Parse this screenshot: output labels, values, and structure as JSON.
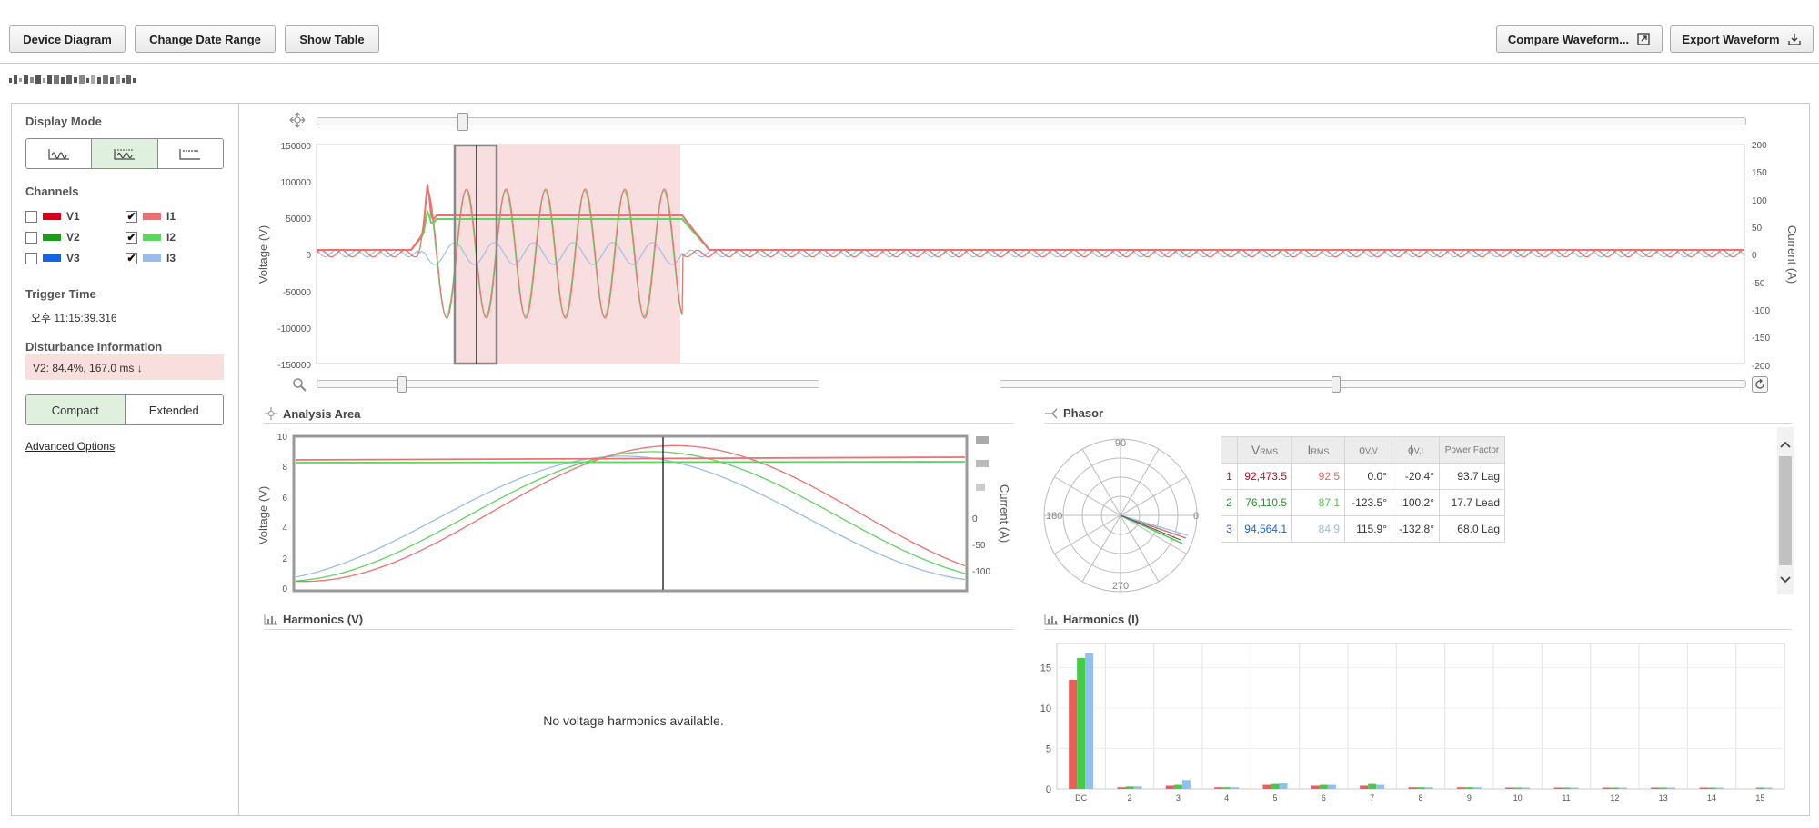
{
  "toolbar": {
    "device_diagram": "Device Diagram",
    "change_date_range": "Change Date Range",
    "show_table": "Show Table",
    "compare_waveform": "Compare Waveform...",
    "export_waveform": "Export Waveform"
  },
  "sidebar": {
    "display_mode_title": "Display Mode",
    "channels_title": "Channels",
    "channels": [
      {
        "label": "V1",
        "checked": false,
        "color": "#d9001b"
      },
      {
        "label": "V2",
        "checked": false,
        "color": "#1f9a1f"
      },
      {
        "label": "V3",
        "checked": false,
        "color": "#1565e0"
      },
      {
        "label": "I1",
        "checked": true,
        "color": "#f07070"
      },
      {
        "label": "I2",
        "checked": true,
        "color": "#5fd45f"
      },
      {
        "label": "I3",
        "checked": true,
        "color": "#99bde8"
      }
    ],
    "trigger_time_title": "Trigger Time",
    "trigger_time": "오후 11:15:39.316",
    "disturbance_title": "Disturbance Information",
    "disturbance": "V2: 84.4%, 167.0 ms ↓",
    "view_compact": "Compact",
    "view_extended": "Extended",
    "advanced_options": "Advanced Options"
  },
  "main_chart": {
    "y_left_label": "Voltage (V)",
    "y_right_label": "Current (A)",
    "y_left_ticks": [
      "150000",
      "100000",
      "50000",
      "0",
      "-50000",
      "-100000",
      "-150000"
    ],
    "y_right_ticks": [
      "200",
      "150",
      "100",
      "50",
      "0",
      "-50",
      "-100",
      "-150",
      "-200"
    ]
  },
  "analysis": {
    "title": "Analysis Area",
    "y_left_label": "Voltage (V)",
    "y_right_label": "Current (A)",
    "y_left_ticks": [
      "10",
      "8",
      "6",
      "4",
      "2",
      "0"
    ],
    "y_right_ticks": [
      "0",
      "-50",
      "-100"
    ]
  },
  "phasor": {
    "title": "Phasor",
    "angles": [
      "90",
      "180",
      "0",
      "270"
    ],
    "headers": {
      "v_rms": "V",
      "v_rms_sub": "RMS",
      "i_rms": "I",
      "i_rms_sub": "RMS",
      "phi_vv": "ϕ",
      "phi_vv_sub": "V,V",
      "phi_vi": "ϕ",
      "phi_vi_sub": "V,I",
      "pf": "Power Factor"
    },
    "rows": [
      {
        "idx": "1",
        "v": "92,473.5",
        "i": "92.5",
        "vv": "0.0°",
        "vi": "-20.4°",
        "pf": "93.7 Lag"
      },
      {
        "idx": "2",
        "v": "76,110.5",
        "i": "87.1",
        "vv": "-123.5°",
        "vi": "100.2°",
        "pf": "17.7 Lead"
      },
      {
        "idx": "3",
        "v": "94,564.1",
        "i": "84.9",
        "vv": "115.9°",
        "vi": "-132.8°",
        "pf": "68.0 Lag"
      }
    ]
  },
  "harmonics_v": {
    "title": "Harmonics (V)",
    "empty_message": "No voltage harmonics available."
  },
  "harmonics_i": {
    "title": "Harmonics (I)"
  },
  "chart_data": {
    "type": "bar",
    "title": "Harmonics (I)",
    "categories": [
      "DC",
      "2",
      "3",
      "4",
      "5",
      "6",
      "7",
      "8",
      "9",
      "10",
      "11",
      "12",
      "13",
      "14",
      "15"
    ],
    "series": [
      {
        "values": [
          13.5,
          0.2,
          0.4,
          0.2,
          0.5,
          0.4,
          0.4,
          0.2,
          0.2,
          0.1,
          0.1,
          0.1,
          0.1,
          0.1,
          0.0
        ],
        "color": "#f05a5a"
      },
      {
        "values": [
          16.2,
          0.3,
          0.5,
          0.2,
          0.6,
          0.5,
          0.6,
          0.2,
          0.2,
          0.1,
          0.1,
          0.1,
          0.1,
          0.1,
          0.1
        ],
        "color": "#44cc44"
      },
      {
        "values": [
          16.8,
          0.3,
          1.1,
          0.2,
          0.7,
          0.5,
          0.5,
          0.2,
          0.2,
          0.1,
          0.1,
          0.1,
          0.1,
          0.1,
          0.1
        ],
        "color": "#8ec0f0"
      }
    ],
    "ylim": [
      0,
      18
    ],
    "y_ticks": [
      0,
      5,
      10,
      15
    ],
    "grid": true
  }
}
